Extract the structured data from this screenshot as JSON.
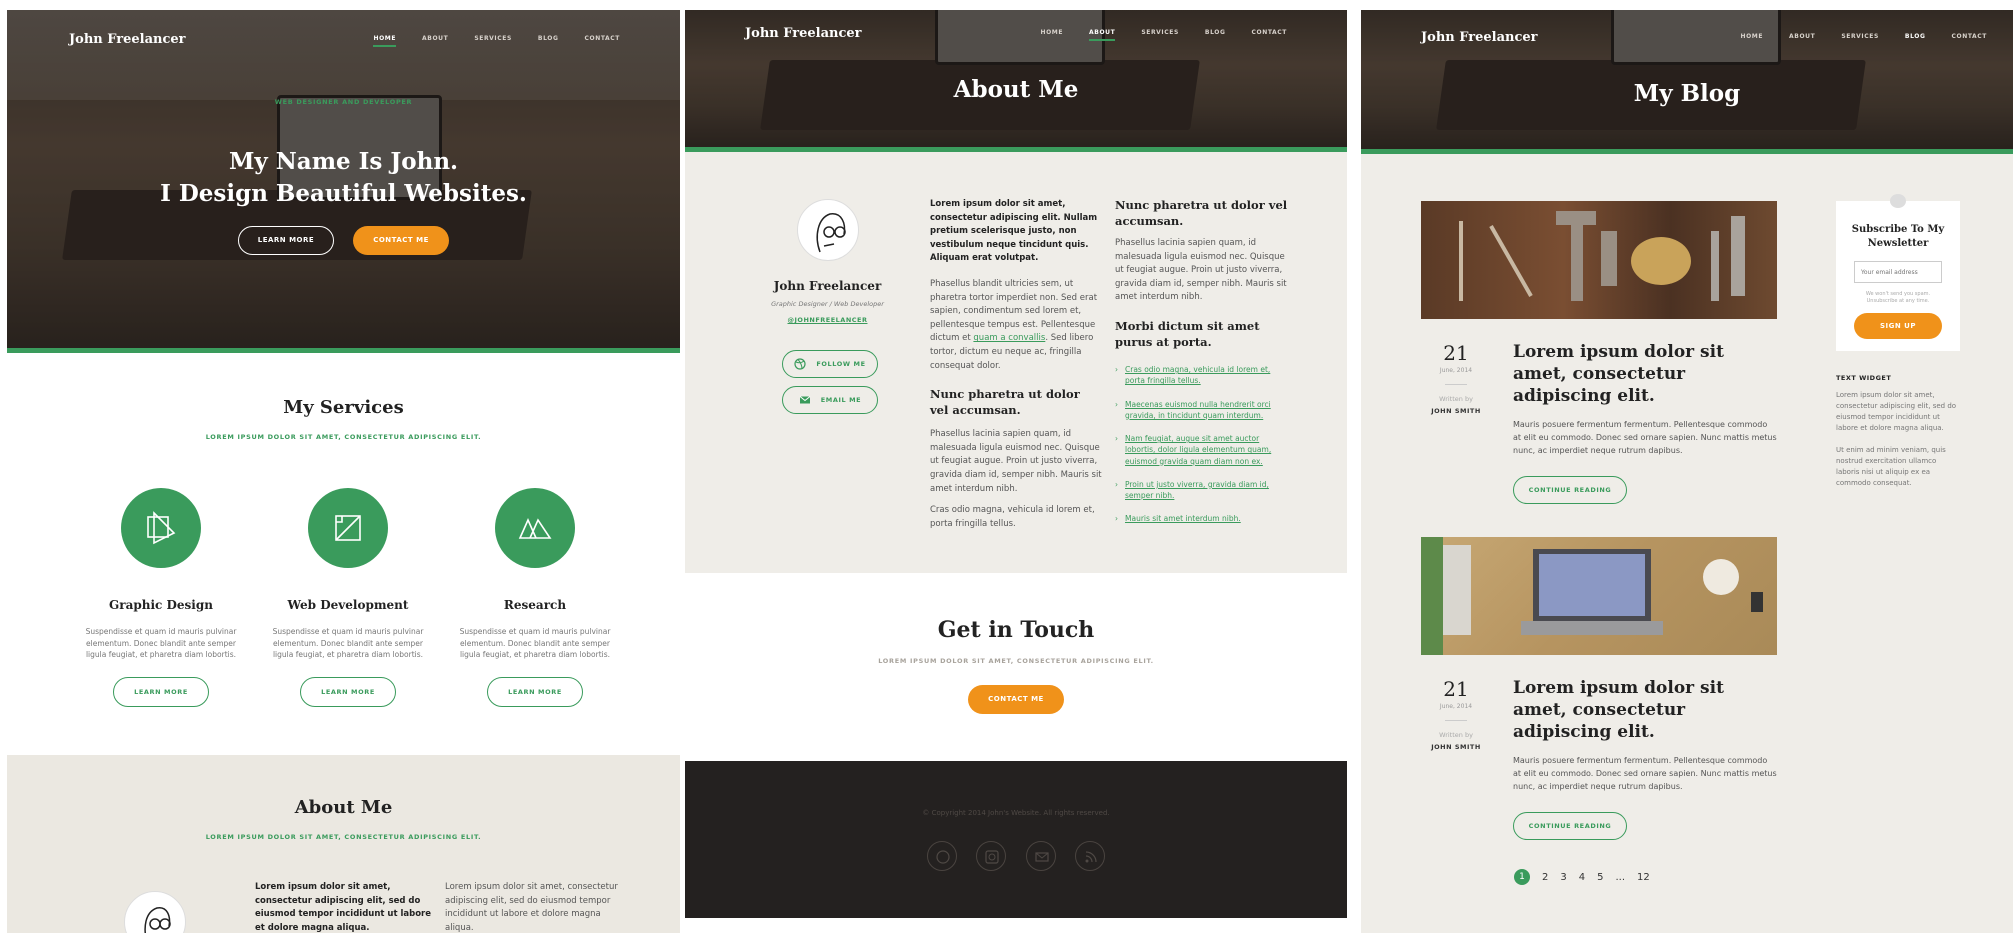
{
  "brand": "John Freelancer",
  "nav": [
    "HOME",
    "ABOUT",
    "SERVICES",
    "BLOG",
    "CONTACT"
  ],
  "panel1": {
    "eyebrow": "WEB DESIGNER AND DEVELOPER",
    "headline1": "My Name Is John.",
    "headline2": "I Design Beautiful Websites.",
    "btn_learn": "LEARN MORE",
    "btn_contact": "CONTACT ME",
    "services_title": "My Services",
    "services_sub": "LOREM IPSUM DOLOR SIT AMET, CONSECTETUR ADIPISCING ELIT.",
    "services": [
      {
        "title": "Graphic Design",
        "text": "Suspendisse et quam id mauris pulvinar elementum. Donec blandit ante semper ligula feugiat, et pharetra diam lobortis.",
        "btn": "LEARN MORE"
      },
      {
        "title": "Web Development",
        "text": "Suspendisse et quam id mauris pulvinar elementum. Donec blandit ante semper ligula feugiat, et pharetra diam lobortis.",
        "btn": "LEARN MORE"
      },
      {
        "title": "Research",
        "text": "Suspendisse et quam id mauris pulvinar elementum. Donec blandit ante semper ligula feugiat, et pharetra diam lobortis.",
        "btn": "LEARN MORE"
      }
    ],
    "about_title": "About Me",
    "about_sub": "LOREM IPSUM DOLOR SIT AMET, CONSECTETUR ADIPISCING ELIT.",
    "about_bold": "Lorem ipsum dolor sit amet, consectetur adipiscing elit, sed do eiusmod tempor incididunt ut labore et dolore magna aliqua.",
    "about_text": "Lorem ipsum dolor sit amet, consectetur adipiscing elit, sed do eiusmod tempor incididunt ut labore et dolore magna aliqua."
  },
  "panel2": {
    "title": "About Me",
    "name": "John Freelancer",
    "role": "Graphic Designer / Web Developer",
    "handle": "@JOHNFREELANCER",
    "follow": "FOLLOW ME",
    "email": "EMAIL ME",
    "intro_bold": "Lorem ipsum dolor sit amet, consectetur adipiscing elit. Nullam pretium scelerisque justo, non vestibulum neque tincidunt quis. Aliquam erat volutpat.",
    "para1_a": "Phasellus blandit ultricies sem, ut pharetra tortor imperdiet non. Sed erat sapien, condimentum sed lorem et, pellentesque tempus est. Pellentesque dictum et",
    "para1_link": "quam a convallis",
    "para1_b": ". Sed libero tortor, dictum eu neque ac, fringilla consequat dolor.",
    "h_mid": "Nunc pharetra ut dolor vel accumsan.",
    "para2": "Phasellus lacinia sapien quam, id malesuada ligula euismod nec. Quisque ut feugiat augue. Proin ut justo viverra, gravida diam id, semper nibh. Mauris sit amet interdum nibh.",
    "para3": "Cras odio magna, vehicula id lorem et, porta fringilla tellus.",
    "h_right1": "Nunc pharetra ut dolor vel accumsan.",
    "para_right": "Phasellus lacinia sapien quam, id malesuada ligula euismod nec. Quisque ut feugiat augue. Proin ut justo viverra, gravida diam id, semper nibh. Mauris sit amet interdum nibh.",
    "h_right2": "Morbi dictum sit amet purus at porta.",
    "list": [
      "Cras odio magna, vehicula id lorem et, porta fringilla tellus.",
      "Maecenas euismod nulla hendrerit orci gravida, in tincidunt quam interdum.",
      "Nam feugiat, augue sit amet auctor lobortis, dolor ligula elementum quam, euismod gravida quam diam non ex.",
      "Proin ut justo viverra, gravida diam id, semper nibh.",
      "Mauris sit amet interdum nibh."
    ],
    "touch_title": "Get in Touch",
    "touch_sub": "LOREM IPSUM DOLOR SIT AMET, CONSECTETUR ADIPISCING ELIT.",
    "touch_btn": "CONTACT ME",
    "copyright": "© Copyright 2014 John's Website. All rights reserved."
  },
  "panel3": {
    "title": "My Blog",
    "posts": [
      {
        "day": "21",
        "month": "June, 2014",
        "written": "Written by",
        "author": "JOHN SMITH",
        "title": "Lorem ipsum dolor sit amet, consectetur adipiscing elit.",
        "excerpt": "Mauris posuere fermentum fermentum. Pellentesque commodo at elit eu commodo. Donec sed ornare sapien. Nunc mattis metus nunc, ac imperdiet neque rutrum dapibus.",
        "btn": "CONTINUE READING"
      },
      {
        "day": "21",
        "month": "June, 2014",
        "written": "Written by",
        "author": "JOHN SMITH",
        "title": "Lorem ipsum dolor sit amet, consectetur adipiscing elit.",
        "excerpt": "Mauris posuere fermentum fermentum. Pellentesque commodo at elit eu commodo. Donec sed ornare sapien. Nunc mattis metus nunc, ac imperdiet neque rutrum dapibus.",
        "btn": "CONTINUE READING"
      }
    ],
    "pages": [
      "1",
      "2",
      "3",
      "4",
      "5",
      "...",
      "12"
    ],
    "newsletter_title": "Subscribe To My Newsletter",
    "newsletter_placeholder": "Your email address",
    "newsletter_note": "We won't send you spam. Unsubscribe at any time.",
    "newsletter_btn": "SIGN UP",
    "widget_title": "TEXT WIDGET",
    "widget_p1": "Lorem ipsum dolor sit amet, consectetur adipiscing elit, sed do eiusmod tempor incididunt ut labore et dolore magna aliqua.",
    "widget_p2": "Ut enim ad minim veniam, quis nostrud exercitation ullamco laboris nisi ut aliquip ex ea commodo consequat."
  }
}
